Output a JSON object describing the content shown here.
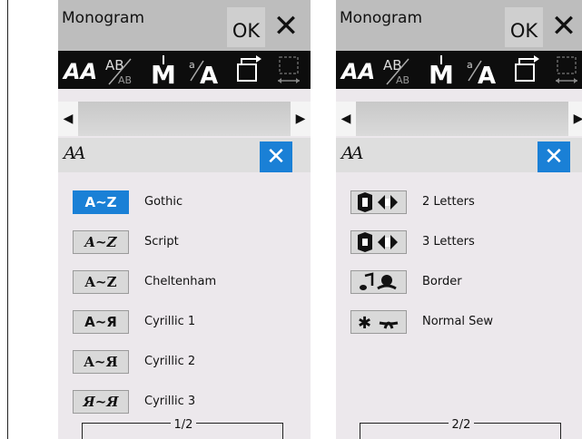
{
  "left_panel": {
    "title": "Monogram",
    "ok_label": "OK",
    "close_glyph": "✕",
    "scroll_left": "◀",
    "scroll_right": "▶",
    "subheader_title": "AA",
    "subheader_close": "✕",
    "items": [
      {
        "button": "A~Z",
        "label": "Gothic",
        "selected": true
      },
      {
        "button": "A~Z",
        "label": "Script",
        "selected": false
      },
      {
        "button": "A~Z",
        "label": "Cheltenham",
        "selected": false
      },
      {
        "button": "A~Я",
        "label": "Cyrillic 1",
        "selected": false
      },
      {
        "button": "A~Я",
        "label": "Cyrillic 2",
        "selected": false
      },
      {
        "button": "Я~Я",
        "label": "Cyrillic 3",
        "selected": false
      }
    ],
    "page_indicator": "1/2"
  },
  "right_panel": {
    "title": "Monogram",
    "ok_label": "OK",
    "close_glyph": "✕",
    "scroll_left": "◀",
    "scroll_right": "▶",
    "subheader_title": "AA",
    "subheader_close": "✕",
    "items": [
      {
        "icon": "two-letter-monogram-icon",
        "label": "2 Letters"
      },
      {
        "icon": "three-letter-monogram-icon",
        "label": "3 Letters"
      },
      {
        "icon": "border-icon",
        "label": "Border"
      },
      {
        "icon": "normal-sew-icon",
        "label": "Normal Sew"
      }
    ],
    "page_indicator": "2/2"
  },
  "toolbar_icons": [
    "font-style-icon",
    "letter-size-icon",
    "mirror-icon",
    "case-icon",
    "back-icon",
    "spacing-icon"
  ],
  "colors": {
    "accent": "#1a80d6",
    "toolbar": "#0d0d0d",
    "panel_bg": "#ece8ec"
  }
}
